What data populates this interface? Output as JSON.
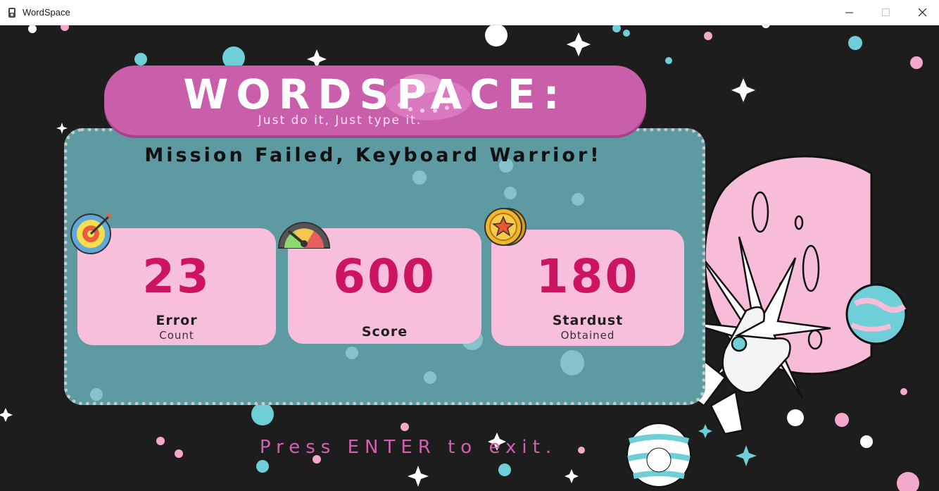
{
  "window": {
    "title": "WordSpace",
    "icon": "app-icon"
  },
  "logo": {
    "title": "WORDSPACE:",
    "tagline": "Just do it, Just type it."
  },
  "result": {
    "headline": "Mission Failed, Keyboard Warrior!"
  },
  "stats": [
    {
      "value": "23",
      "label": "Error",
      "sublabel": "Count",
      "icon": "target-icon"
    },
    {
      "value": "600",
      "label": "Score",
      "sublabel": "",
      "icon": "speedometer-icon"
    },
    {
      "value": "180",
      "label": "Stardust",
      "sublabel": "Obtained",
      "icon": "star-coin-icon"
    }
  ],
  "prompt": "Press ENTER to exit.",
  "colors": {
    "background": "#1d1d1d",
    "panel": "#5e9aa2",
    "logo": "#c95eaa",
    "card": "#f7bfdc",
    "value": "#cc1460",
    "prompt": "#d060b0"
  }
}
